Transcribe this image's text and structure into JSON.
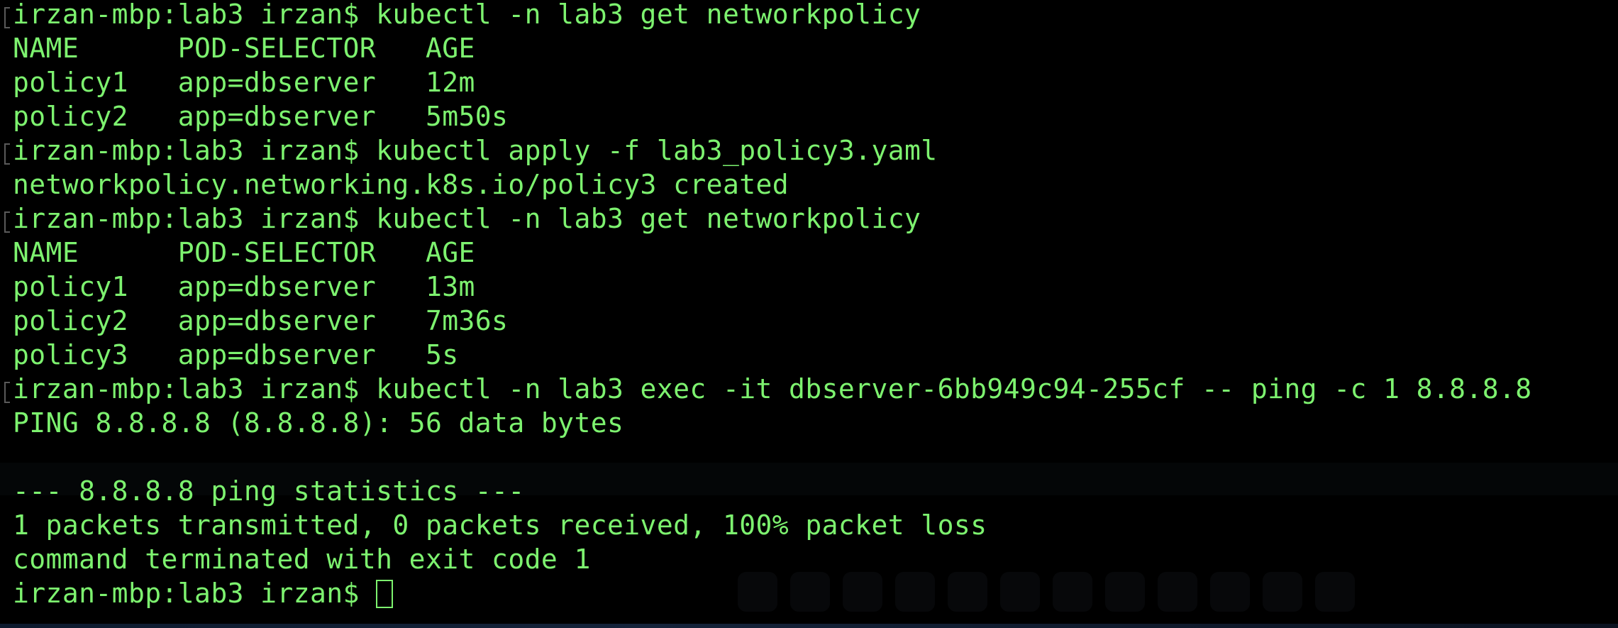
{
  "terminal": {
    "lines": [
      "irzan-mbp:lab3 irzan$ kubectl -n lab3 get networkpolicy",
      "NAME      POD-SELECTOR   AGE",
      "policy1   app=dbserver   12m",
      "policy2   app=dbserver   5m50s",
      "irzan-mbp:lab3 irzan$ kubectl apply -f lab3_policy3.yaml",
      "networkpolicy.networking.k8s.io/policy3 created",
      "irzan-mbp:lab3 irzan$ kubectl -n lab3 get networkpolicy",
      "NAME      POD-SELECTOR   AGE",
      "policy1   app=dbserver   13m",
      "policy2   app=dbserver   7m36s",
      "policy3   app=dbserver   5s",
      "irzan-mbp:lab3 irzan$ kubectl -n lab3 exec -it dbserver-6bb949c94-255cf -- ping -c 1 8.8.8.8",
      "PING 8.8.8.8 (8.8.8.8): 56 data bytes",
      "",
      "--- 8.8.8.8 ping statistics ---",
      "1 packets transmitted, 0 packets received, 100% packet loss",
      "command terminated with exit code 1"
    ],
    "prompt": "irzan-mbp:lab3 irzan$ ",
    "text_color": "#7df26f",
    "background_color": "#000000"
  }
}
